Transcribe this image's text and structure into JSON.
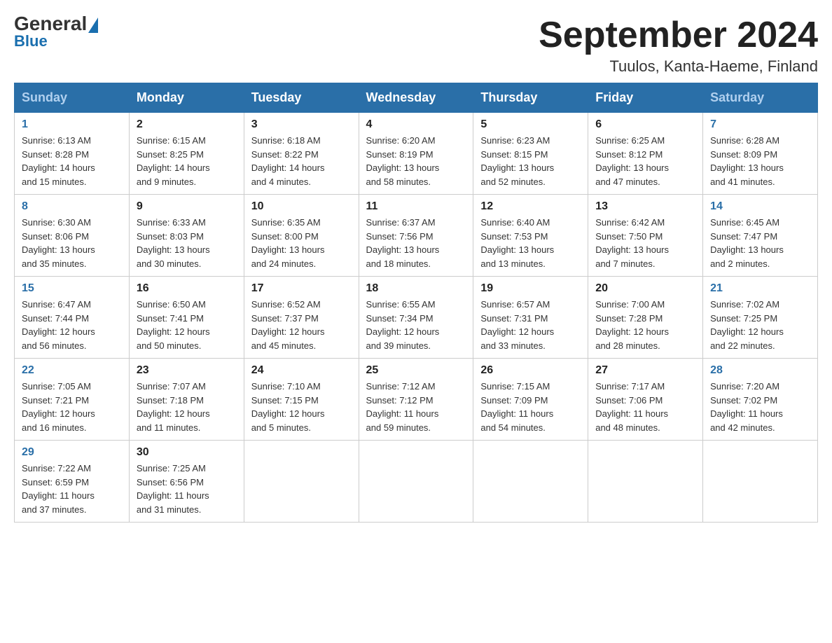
{
  "header": {
    "logo_general": "General",
    "logo_blue": "Blue",
    "month_title": "September 2024",
    "location": "Tuulos, Kanta-Haeme, Finland"
  },
  "days_of_week": [
    "Sunday",
    "Monday",
    "Tuesday",
    "Wednesday",
    "Thursday",
    "Friday",
    "Saturday"
  ],
  "weeks": [
    [
      {
        "day": "1",
        "sunrise": "6:13 AM",
        "sunset": "8:28 PM",
        "daylight": "14 hours and 15 minutes."
      },
      {
        "day": "2",
        "sunrise": "6:15 AM",
        "sunset": "8:25 PM",
        "daylight": "14 hours and 9 minutes."
      },
      {
        "day": "3",
        "sunrise": "6:18 AM",
        "sunset": "8:22 PM",
        "daylight": "14 hours and 4 minutes."
      },
      {
        "day": "4",
        "sunrise": "6:20 AM",
        "sunset": "8:19 PM",
        "daylight": "13 hours and 58 minutes."
      },
      {
        "day": "5",
        "sunrise": "6:23 AM",
        "sunset": "8:15 PM",
        "daylight": "13 hours and 52 minutes."
      },
      {
        "day": "6",
        "sunrise": "6:25 AM",
        "sunset": "8:12 PM",
        "daylight": "13 hours and 47 minutes."
      },
      {
        "day": "7",
        "sunrise": "6:28 AM",
        "sunset": "8:09 PM",
        "daylight": "13 hours and 41 minutes."
      }
    ],
    [
      {
        "day": "8",
        "sunrise": "6:30 AM",
        "sunset": "8:06 PM",
        "daylight": "13 hours and 35 minutes."
      },
      {
        "day": "9",
        "sunrise": "6:33 AM",
        "sunset": "8:03 PM",
        "daylight": "13 hours and 30 minutes."
      },
      {
        "day": "10",
        "sunrise": "6:35 AM",
        "sunset": "8:00 PM",
        "daylight": "13 hours and 24 minutes."
      },
      {
        "day": "11",
        "sunrise": "6:37 AM",
        "sunset": "7:56 PM",
        "daylight": "13 hours and 18 minutes."
      },
      {
        "day": "12",
        "sunrise": "6:40 AM",
        "sunset": "7:53 PM",
        "daylight": "13 hours and 13 minutes."
      },
      {
        "day": "13",
        "sunrise": "6:42 AM",
        "sunset": "7:50 PM",
        "daylight": "13 hours and 7 minutes."
      },
      {
        "day": "14",
        "sunrise": "6:45 AM",
        "sunset": "7:47 PM",
        "daylight": "13 hours and 2 minutes."
      }
    ],
    [
      {
        "day": "15",
        "sunrise": "6:47 AM",
        "sunset": "7:44 PM",
        "daylight": "12 hours and 56 minutes."
      },
      {
        "day": "16",
        "sunrise": "6:50 AM",
        "sunset": "7:41 PM",
        "daylight": "12 hours and 50 minutes."
      },
      {
        "day": "17",
        "sunrise": "6:52 AM",
        "sunset": "7:37 PM",
        "daylight": "12 hours and 45 minutes."
      },
      {
        "day": "18",
        "sunrise": "6:55 AM",
        "sunset": "7:34 PM",
        "daylight": "12 hours and 39 minutes."
      },
      {
        "day": "19",
        "sunrise": "6:57 AM",
        "sunset": "7:31 PM",
        "daylight": "12 hours and 33 minutes."
      },
      {
        "day": "20",
        "sunrise": "7:00 AM",
        "sunset": "7:28 PM",
        "daylight": "12 hours and 28 minutes."
      },
      {
        "day": "21",
        "sunrise": "7:02 AM",
        "sunset": "7:25 PM",
        "daylight": "12 hours and 22 minutes."
      }
    ],
    [
      {
        "day": "22",
        "sunrise": "7:05 AM",
        "sunset": "7:21 PM",
        "daylight": "12 hours and 16 minutes."
      },
      {
        "day": "23",
        "sunrise": "7:07 AM",
        "sunset": "7:18 PM",
        "daylight": "12 hours and 11 minutes."
      },
      {
        "day": "24",
        "sunrise": "7:10 AM",
        "sunset": "7:15 PM",
        "daylight": "12 hours and 5 minutes."
      },
      {
        "day": "25",
        "sunrise": "7:12 AM",
        "sunset": "7:12 PM",
        "daylight": "11 hours and 59 minutes."
      },
      {
        "day": "26",
        "sunrise": "7:15 AM",
        "sunset": "7:09 PM",
        "daylight": "11 hours and 54 minutes."
      },
      {
        "day": "27",
        "sunrise": "7:17 AM",
        "sunset": "7:06 PM",
        "daylight": "11 hours and 48 minutes."
      },
      {
        "day": "28",
        "sunrise": "7:20 AM",
        "sunset": "7:02 PM",
        "daylight": "11 hours and 42 minutes."
      }
    ],
    [
      {
        "day": "29",
        "sunrise": "7:22 AM",
        "sunset": "6:59 PM",
        "daylight": "11 hours and 37 minutes."
      },
      {
        "day": "30",
        "sunrise": "7:25 AM",
        "sunset": "6:56 PM",
        "daylight": "11 hours and 31 minutes."
      },
      null,
      null,
      null,
      null,
      null
    ]
  ],
  "labels": {
    "sunrise": "Sunrise:",
    "sunset": "Sunset:",
    "daylight": "Daylight:"
  }
}
